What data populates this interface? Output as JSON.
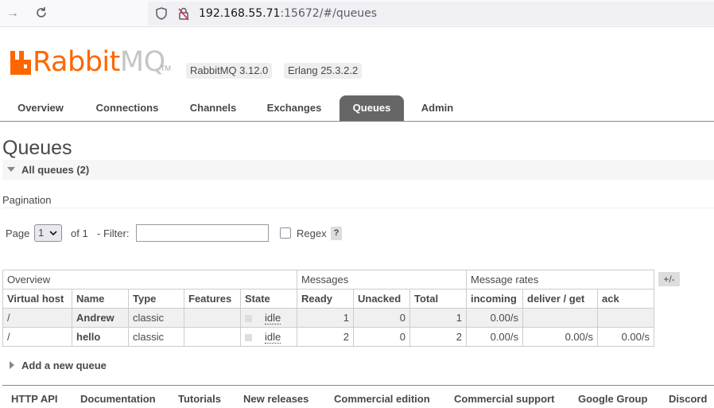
{
  "browser": {
    "url_host": "192.168.55.71",
    "url_rest": ":15672/#/queues"
  },
  "header": {
    "logo_rabbit": "Rabbit",
    "logo_mq": "MQ",
    "logo_tm": "TM",
    "rabbitmq_version": "RabbitMQ 3.12.0",
    "erlang_version": "Erlang 25.3.2.2"
  },
  "tabs": [
    {
      "label": "Overview",
      "active": false
    },
    {
      "label": "Connections",
      "active": false
    },
    {
      "label": "Channels",
      "active": false
    },
    {
      "label": "Exchanges",
      "active": false
    },
    {
      "label": "Queues",
      "active": true
    },
    {
      "label": "Admin",
      "active": false
    }
  ],
  "page": {
    "title": "Queues",
    "section_title": "All queues (2)"
  },
  "pagination": {
    "title": "Pagination",
    "page_label": "Page",
    "page_value": "1",
    "of_label": "of 1",
    "filter_label": "- Filter:",
    "filter_value": "",
    "regex_label": "Regex",
    "regex_checked": false,
    "help": "?"
  },
  "table": {
    "groups": [
      "Overview",
      "Messages",
      "Message rates"
    ],
    "columns": [
      "Virtual host",
      "Name",
      "Type",
      "Features",
      "State",
      "Ready",
      "Unacked",
      "Total",
      "incoming",
      "deliver / get",
      "ack"
    ],
    "rows": [
      {
        "vhost": "/",
        "name": "Andrew",
        "type": "classic",
        "features": "",
        "state": "idle",
        "ready": "1",
        "unacked": "0",
        "total": "1",
        "incoming": "0.00/s",
        "deliver_get": "",
        "ack": ""
      },
      {
        "vhost": "/",
        "name": "hello",
        "type": "classic",
        "features": "",
        "state": "idle",
        "ready": "2",
        "unacked": "0",
        "total": "2",
        "incoming": "0.00/s",
        "deliver_get": "0.00/s",
        "ack": "0.00/s"
      }
    ],
    "columns_toggle": "+/-"
  },
  "add_queue": "Add a new queue",
  "footer": [
    "HTTP API",
    "Documentation",
    "Tutorials",
    "New releases",
    "Commercial edition",
    "Commercial support",
    "Google Group",
    "Discord"
  ],
  "colors": {
    "brand": "#ff6600",
    "tab_active": "#666666"
  }
}
